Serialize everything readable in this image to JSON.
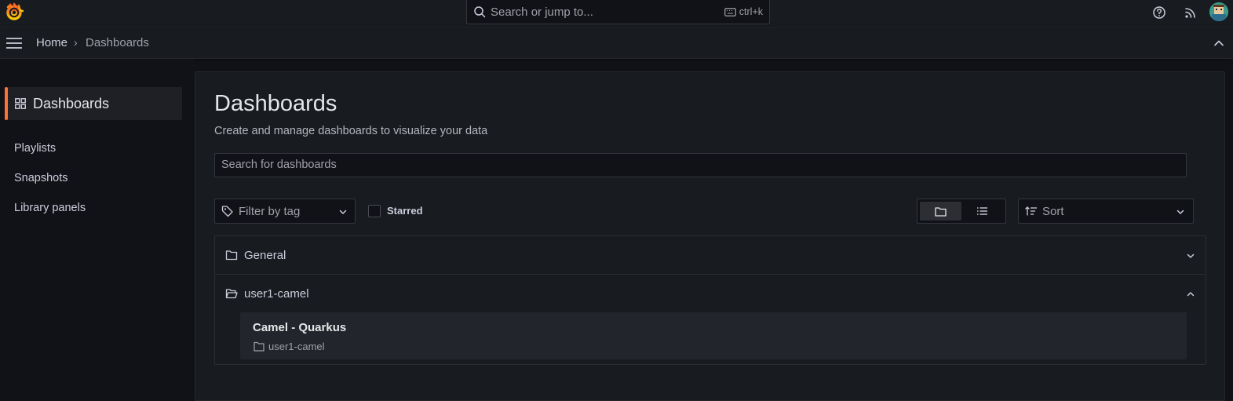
{
  "topbar": {
    "search_placeholder": "Search or jump to...",
    "shortcut": "ctrl+k"
  },
  "breadcrumb": {
    "home": "Home",
    "separator": "›",
    "current": "Dashboards"
  },
  "sidebar": {
    "active": "Dashboards",
    "items": [
      "Playlists",
      "Snapshots",
      "Library panels"
    ]
  },
  "main": {
    "title": "Dashboards",
    "subtitle": "Create and manage dashboards to visualize your data",
    "search_placeholder": "Search for dashboards",
    "filter_tag": "Filter by tag",
    "starred_label": "Starred",
    "starred_checked": false,
    "sort_label": "Sort",
    "view_mode": "folders"
  },
  "folders": [
    {
      "name": "General",
      "expanded": false
    },
    {
      "name": "user1-camel",
      "expanded": true,
      "dashboards": [
        {
          "title": "Camel - Quarkus",
          "folder": "user1-camel"
        }
      ]
    }
  ],
  "colors": {
    "accent": "#ff7134",
    "background": "#111217",
    "panel": "#181b1f"
  }
}
